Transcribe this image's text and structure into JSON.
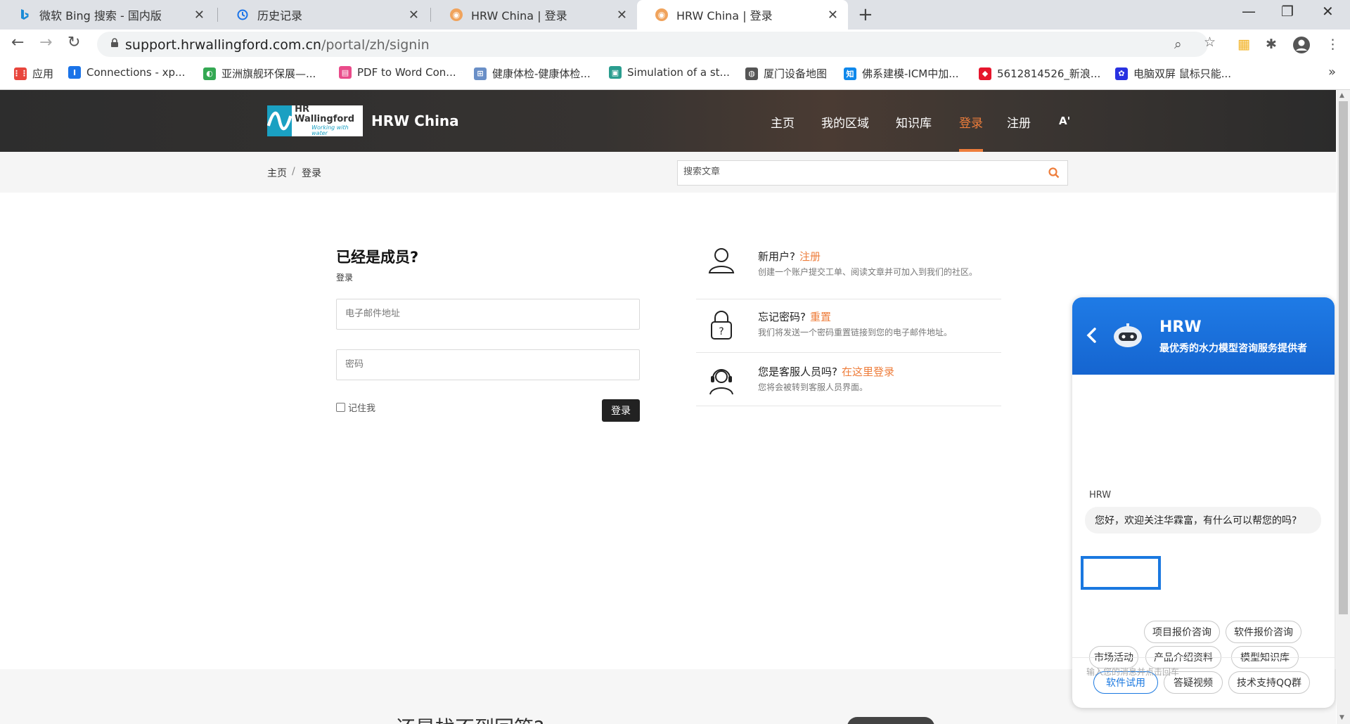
{
  "browser": {
    "tabs": [
      {
        "title": "微软 Bing 搜索 - 国内版",
        "icon": "bing-icon"
      },
      {
        "title": "历史记录",
        "icon": "history-icon"
      },
      {
        "title": "HRW China | 登录",
        "icon": "site-icon"
      },
      {
        "title": "HRW China | 登录",
        "icon": "site-icon",
        "active": true
      }
    ],
    "url_host": "support.hrwallingford.com.cn",
    "url_path": "/portal/zh/signin",
    "bookmarks": [
      {
        "label": "应用",
        "icon": "apps-grid-icon",
        "color": "#e8453c"
      },
      {
        "label": "Connections - xp...",
        "icon": "bookmark-i-icon",
        "color": "#1a73e8"
      },
      {
        "label": "亚洲旗舰环保展—...",
        "icon": "bookmark-ring-icon",
        "color": "#34a853"
      },
      {
        "label": "PDF to Word Con...",
        "icon": "pdf-icon",
        "color": "#e94b8a"
      },
      {
        "label": "健康体检-健康体检...",
        "icon": "health-icon",
        "color": "#6a8fc7"
      },
      {
        "label": "Simulation of a st...",
        "icon": "sim-icon",
        "color": "#2a9d8f"
      },
      {
        "label": "厦门设备地图",
        "icon": "globe-icon",
        "color": "#555555"
      },
      {
        "label": "佛系建模-ICM中加...",
        "icon": "zhihu-icon",
        "color": "#0f88eb"
      },
      {
        "label": "5612814526_新浪...",
        "icon": "weibo-icon",
        "color": "#e6162d"
      },
      {
        "label": "电脑双屏 鼠标只能...",
        "icon": "baidu-paw-icon",
        "color": "#2932e1"
      }
    ],
    "more": "»"
  },
  "site": {
    "brand": "HR Wallingford",
    "tagline": "Working with water",
    "name": "HRW China",
    "nav": [
      {
        "label": "主页"
      },
      {
        "label": "我的区域"
      },
      {
        "label": "知识库"
      },
      {
        "label": "登录",
        "active": true
      },
      {
        "label": "注册"
      },
      {
        "label": "A'"
      }
    ],
    "accent": "#ee7d3b"
  },
  "breadcrumb": {
    "home": "主页",
    "sep": "/",
    "current": "登录"
  },
  "search": {
    "placeholder": "搜索文章"
  },
  "login": {
    "title": "已经是成员?",
    "subtitle": "登录",
    "email_placeholder": "电子邮件地址",
    "password_placeholder": "密码",
    "remember": "记住我",
    "submit": "登录"
  },
  "options": [
    {
      "title": "新用户?",
      "link": "注册",
      "desc": "创建一个账户提交工单、阅读文章并可加入到我们的社区。",
      "icon": "user-icon"
    },
    {
      "title": "忘记密码?",
      "link": "重置",
      "desc": "我们将发送一个密码重置链接到您的电子邮件地址。",
      "icon": "lock-question-icon"
    },
    {
      "title": "您是客服人员吗?",
      "link": "在这里登录",
      "desc": "您将会被转到客服人员界面。",
      "icon": "headset-agent-icon"
    }
  ],
  "footer": {
    "text": "还是找不到回答?"
  },
  "chat": {
    "name": "HRW",
    "tagline": "最优秀的水力模型咨询服务提供者",
    "sender": "HRW",
    "greeting": "您好，欢迎关注华霖富，有什么可以帮您的吗?",
    "chips": [
      "项目报价咨询",
      "软件报价咨询",
      "市场活动",
      "产品介绍资料",
      "模型知识库",
      "软件试用",
      "答疑视频",
      "技术支持QQ群"
    ],
    "selected_chip": "软件试用",
    "input_placeholder": "输入您的消息并点击回车",
    "accent": "#1a78e0"
  }
}
